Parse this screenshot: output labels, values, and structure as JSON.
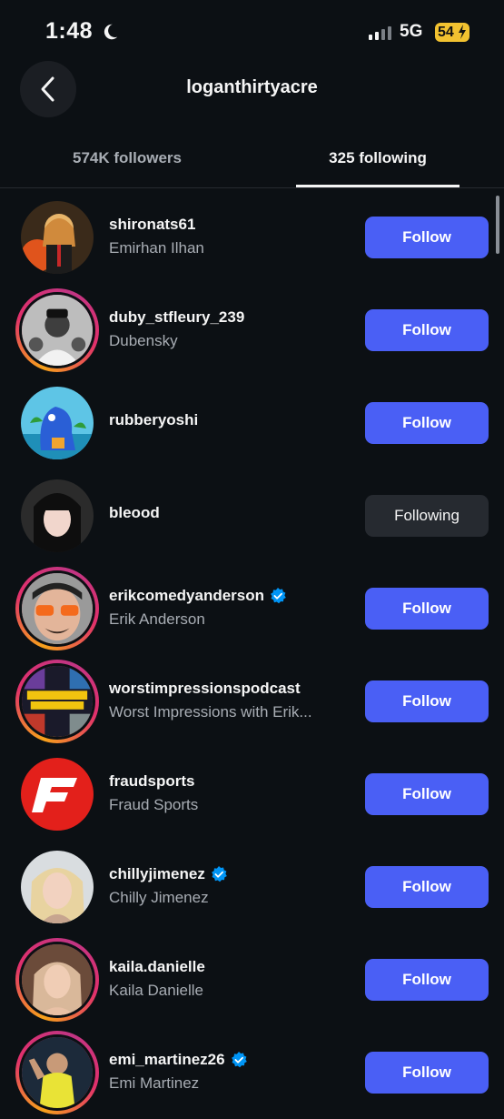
{
  "status": {
    "time": "1:48",
    "network": "5G",
    "battery": "54"
  },
  "header": {
    "title": "loganthirtyacre"
  },
  "tabs": {
    "followers": "574K followers",
    "following": "325 following"
  },
  "rows": [
    {
      "username": "shironats61",
      "fullname": "Emirhan Ilhan",
      "button": "Follow",
      "button_state": "follow"
    },
    {
      "username": "duby_stfleury_239",
      "fullname": "Dubensky",
      "button": "Follow",
      "button_state": "follow"
    },
    {
      "username": "rubberyoshi",
      "fullname": "",
      "button": "Follow",
      "button_state": "follow"
    },
    {
      "username": "bleood",
      "fullname": "",
      "button": "Following",
      "button_state": "following"
    },
    {
      "username": "erikcomedyanderson",
      "fullname": "Erik Anderson",
      "button": "Follow",
      "button_state": "follow",
      "verified": true
    },
    {
      "username": "worstimpressionspodcast",
      "fullname": "Worst Impressions with Erik...",
      "button": "Follow",
      "button_state": "follow"
    },
    {
      "username": "fraudsports",
      "fullname": "Fraud Sports",
      "button": "Follow",
      "button_state": "follow"
    },
    {
      "username": "chillyjimenez",
      "fullname": "Chilly Jimenez",
      "button": "Follow",
      "button_state": "follow",
      "verified": true
    },
    {
      "username": "kaila.danielle",
      "fullname": "Kaila Danielle",
      "button": "Follow",
      "button_state": "follow"
    },
    {
      "username": "emi_martinez26",
      "fullname": "Emi Martinez",
      "button": "Follow",
      "button_state": "follow",
      "verified": true
    }
  ],
  "colors": {
    "background": "#0c1014",
    "follow_button": "#4a5ff5",
    "following_button": "#262a30",
    "verified": "#0095f6"
  }
}
